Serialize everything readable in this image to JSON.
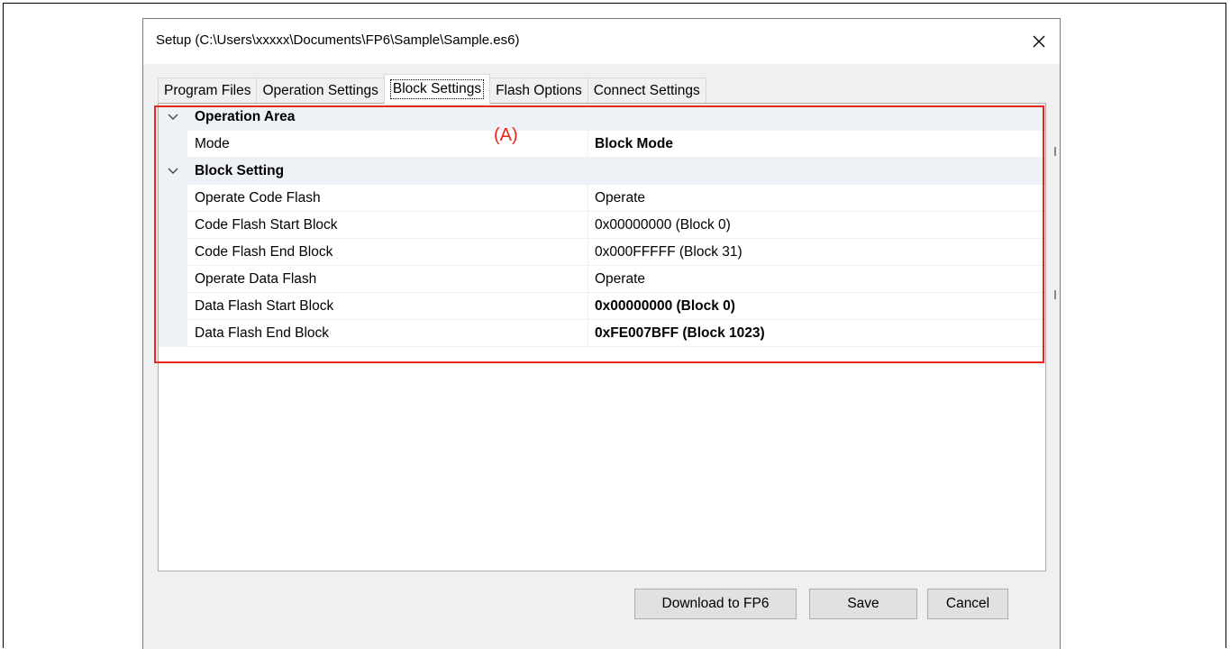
{
  "window": {
    "title": "Setup (C:\\Users\\xxxxx\\Documents\\FP6\\Sample\\Sample.es6)",
    "close_icon": "close-icon"
  },
  "tabs": [
    {
      "label": "Program Files",
      "active": false
    },
    {
      "label": "Operation Settings",
      "active": false
    },
    {
      "label": "Block Settings",
      "active": true
    },
    {
      "label": "Flash Options",
      "active": false
    },
    {
      "label": "Connect Settings",
      "active": false
    }
  ],
  "property_grid": {
    "categories": [
      {
        "name": "Operation Area",
        "expanded": true,
        "properties": [
          {
            "name": "Mode",
            "value": "Block Mode",
            "bold": true
          }
        ]
      },
      {
        "name": "Block Setting",
        "expanded": true,
        "properties": [
          {
            "name": "Operate Code Flash",
            "value": "Operate",
            "bold": false
          },
          {
            "name": "Code Flash Start Block",
            "value": "0x00000000 (Block 0)",
            "bold": false
          },
          {
            "name": "Code Flash End Block",
            "value": "0x000FFFFF (Block 31)",
            "bold": false
          },
          {
            "name": "Operate Data Flash",
            "value": "Operate",
            "bold": false
          },
          {
            "name": "Data Flash Start Block",
            "value": "0x00000000 (Block 0)",
            "bold": true
          },
          {
            "name": "Data Flash End Block",
            "value": "0xFE007BFF (Block 1023)",
            "bold": true
          }
        ]
      }
    ]
  },
  "annotation": {
    "label": "(A)",
    "color": "#e8261c"
  },
  "buttons": {
    "download": "Download to FP6",
    "save": "Save",
    "cancel": "Cancel"
  }
}
